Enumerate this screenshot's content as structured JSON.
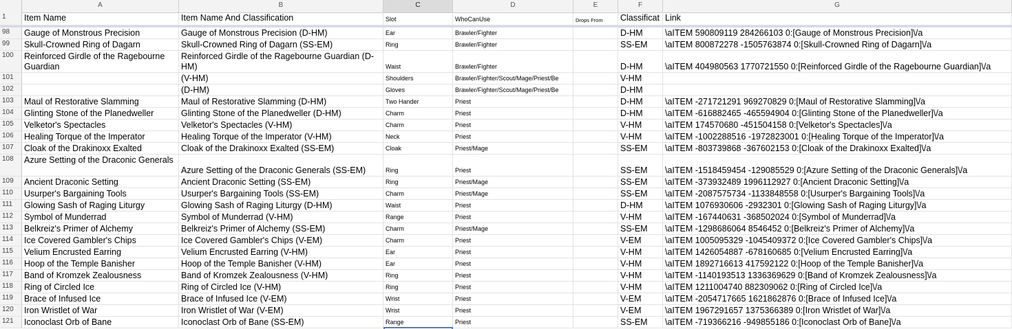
{
  "columns": [
    "A",
    "B",
    "C",
    "D",
    "E",
    "F",
    "G"
  ],
  "selected_column": "C",
  "header": {
    "row_num": "1",
    "item_name": "Item Name",
    "item_name_class": "Item Name And Classification",
    "slot": "Slot",
    "who": "WhoCanUse",
    "drops": "Drops From",
    "classification": "Classificat",
    "link": "Link"
  },
  "rows": [
    {
      "n": "98",
      "a": "Gauge of Monstrous Precision",
      "b": "Gauge of Monstrous Precision (D-HM)",
      "c": "Ear",
      "d": "Brawler/Fighter",
      "f": "D-HM",
      "g": "\\aITEM 590809119 284266103 0:[Gauge of Monstrous Precision]\\/a"
    },
    {
      "n": "99",
      "a": "Skull-Crowned Ring of Dagarn",
      "b": "Skull-Crowned Ring of Dagarn (SS-EM)",
      "c": "Ring",
      "d": "Brawler/Fighter",
      "f": "SS-EM",
      "g": "\\aITEM 800872278 -1505763874 0:[Skull-Crowned Ring of Dagarn]\\/a"
    },
    {
      "n": "100",
      "a": "Reinforced Girdle of the Ragebourne Guardian",
      "b": "Reinforced Girdle of the Ragebourne Guardian (D-HM)",
      "c": "Waist",
      "d": "Brawler/Fighter",
      "f": "D-HM",
      "g": "\\aITEM 404980563 1770721550 0:[Reinforced Girdle of the Ragebourne Guardian]\\/a",
      "tall": true
    },
    {
      "n": "101",
      "a": "",
      "b": "(V-HM)",
      "c": "Shoulders",
      "d": "Brawler/Fighter/Scout/Mage/Priest/Be",
      "f": "V-HM",
      "g": ""
    },
    {
      "n": "102",
      "a": "",
      "b": "(D-HM)",
      "c": "Gloves",
      "d": "Brawler/Fighter/Scout/Mage/Priest/Be",
      "f": "D-HM",
      "g": ""
    },
    {
      "n": "103",
      "a": "Maul of Restorative Slamming",
      "b": "Maul of Restorative Slamming (D-HM)",
      "c": "Two Hander",
      "d": "Priest",
      "f": "D-HM",
      "g": "\\aITEM -271721291 969270829 0:[Maul of Restorative Slamming]\\/a"
    },
    {
      "n": "104",
      "a": "Glinting Stone of the Planedweller",
      "b": "Glinting Stone of the Planedweller (D-HM)",
      "c": "Charm",
      "d": "Priest",
      "f": "D-HM",
      "g": "\\aITEM -616882465 -465594904 0:[Glinting Stone of the Planedweller]\\/a"
    },
    {
      "n": "105",
      "a": "Velketor's Spectacles",
      "b": "Velketor's Spectacles (V-HM)",
      "c": "Charm",
      "d": "Priest",
      "f": "V-HM",
      "g": "\\aITEM 174570680 -451504158 0:[Velketor's Spectacles]\\/a"
    },
    {
      "n": "106",
      "a": "Healing Torque of the Imperator",
      "b": "Healing Torque of the Imperator (V-HM)",
      "c": "Neck",
      "d": "Priest",
      "f": "V-HM",
      "g": "\\aITEM -1002288516 -1972823001 0:[Healing Torque of the Imperator]\\/a"
    },
    {
      "n": "107",
      "a": "Cloak of the Drakinoxx Exalted",
      "b": "Cloak of the Drakinoxx Exalted (SS-EM)",
      "c": "Cloak",
      "d": "Priest/Mage",
      "f": "SS-EM",
      "g": "\\aITEM -803739868 -367602153 0:[Cloak of the Drakinoxx Exalted]\\/a"
    },
    {
      "n": "108",
      "a": "Azure Setting of the Draconic Generals",
      "b": "Azure Setting of the Draconic Generals (SS-EM)",
      "c": "Ring",
      "d": "Priest",
      "f": "SS-EM",
      "g": "\\aITEM -1518459454 -129085529 0:[Azure Setting of the Draconic Generals]\\/a",
      "tall": true
    },
    {
      "n": "109",
      "a": "Ancient Draconic Setting",
      "b": "Ancient Draconic Setting (SS-EM)",
      "c": "Ring",
      "d": "Priest/Mage",
      "f": "SS-EM",
      "g": "\\aITEM -373932489 1996112927 0:[Ancient Draconic Setting]\\/a"
    },
    {
      "n": "110",
      "a": "Usurper's Bargaining Tools",
      "b": "Usurper's Bargaining Tools (SS-EM)",
      "c": "Charm",
      "d": "Priest/Mage",
      "f": "SS-EM",
      "g": "\\aITEM -2087575734 -1133848558 0:[Usurper's Bargaining Tools]\\/a"
    },
    {
      "n": "111",
      "a": "Glowing Sash of Raging Liturgy",
      "b": "Glowing Sash of Raging Liturgy (D-HM)",
      "c": "Waist",
      "d": "Priest",
      "f": "D-HM",
      "g": "\\aITEM 1076930606 -2932301 0:[Glowing Sash of Raging Liturgy]\\/a"
    },
    {
      "n": "112",
      "a": "Symbol of Munderrad",
      "b": "Symbol of Munderrad (V-HM)",
      "c": "Range",
      "d": "Priest",
      "f": "V-HM",
      "g": "\\aITEM -167440631 -368502024 0:[Symbol of Munderrad]\\/a"
    },
    {
      "n": "113",
      "a": "Belkreiz's Primer of Alchemy",
      "b": "Belkreiz's Primer of Alchemy (SS-EM)",
      "c": "Charm",
      "d": "Priest/Mage",
      "f": "SS-EM",
      "g": "\\aITEM -1298686064 8546452 0:[Belkreiz's Primer of Alchemy]\\/a"
    },
    {
      "n": "114",
      "a": "Ice Covered Gambler's Chips",
      "b": "Ice Covered Gambler's Chips (V-EM)",
      "c": "Charm",
      "d": "Priest",
      "f": "V-EM",
      "g": "\\aITEM 1005095329 -1045409372 0:[Ice Covered Gambler's Chips]\\/a"
    },
    {
      "n": "115",
      "a": "Velium Encrusted Earring",
      "b": "Velium Encrusted Earring (V-HM)",
      "c": "Ear",
      "d": "Priest",
      "f": "V-HM",
      "g": "\\aITEM 1426054887 -678160685 0:[Velium Encrusted Earring]\\/a"
    },
    {
      "n": "116",
      "a": "Hoop of the Temple Banisher",
      "b": "Hoop of the Temple Banisher (V-HM)",
      "c": "Ear",
      "d": "Priest",
      "f": "V-HM",
      "g": "\\aITEM 1892716613 417592122 0:[Hoop of the Temple Banisher]\\/a"
    },
    {
      "n": "117",
      "a": "Band of Kromzek Zealousness",
      "b": "Band of Kromzek Zealousness (V-HM)",
      "c": "Ring",
      "d": "Priest",
      "f": "V-HM",
      "g": "\\aITEM -1140193513 1336369629 0:[Band of Kromzek Zealousness]\\/a"
    },
    {
      "n": "118",
      "a": "Ring of Circled Ice",
      "b": "Ring of Circled Ice (V-HM)",
      "c": "Ring",
      "d": "Priest",
      "f": "V-HM",
      "g": "\\aITEM 1211004740 882309062 0:[Ring of Circled Ice]\\/a"
    },
    {
      "n": "119",
      "a": "Brace of Infused Ice",
      "b": "Brace of Infused Ice (V-EM)",
      "c": "Wrist",
      "d": "Priest",
      "f": "V-EM",
      "g": "\\aITEM -2054717665 1621862876 0:[Brace of Infused Ice]\\/a"
    },
    {
      "n": "120",
      "a": "Iron Wristlet of War",
      "b": "Iron Wristlet of War (V-EM)",
      "c": "Wrist",
      "d": "Priest",
      "f": "V-EM",
      "g": "\\aITEM 1967291657 1375366389 0:[Iron Wristlet of War]\\/a"
    },
    {
      "n": "121",
      "a": "Iconoclast Orb of Bane",
      "b": "Iconoclast Orb of Bane (SS-EM)",
      "c": "Range",
      "d": "Priest",
      "f": "SS-EM",
      "g": "\\aITEM -719366216 -949855186 0:[Iconoclast Orb of Bane]\\/a"
    }
  ]
}
